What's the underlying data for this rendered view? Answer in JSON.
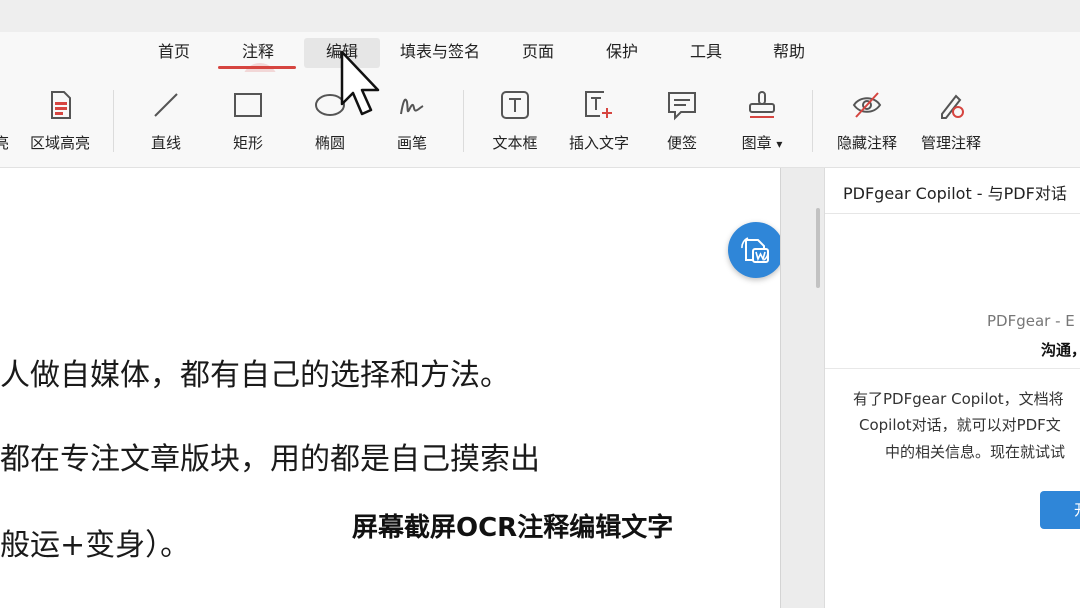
{
  "menu": {
    "tabs": [
      {
        "label": "首页"
      },
      {
        "label": "注释"
      },
      {
        "label": "编辑"
      },
      {
        "label": "填表与签名"
      },
      {
        "label": "页面"
      },
      {
        "label": "保护"
      },
      {
        "label": "工具"
      },
      {
        "label": "帮助"
      }
    ],
    "active_tab": "注释",
    "accent_color": "#d64540"
  },
  "toolbar": {
    "items": [
      {
        "label": "区域高亮",
        "icon": "area-highlight-icon"
      },
      {
        "label": "直线",
        "icon": "line-icon"
      },
      {
        "label": "矩形",
        "icon": "rectangle-icon"
      },
      {
        "label": "椭圆",
        "icon": "ellipse-icon"
      },
      {
        "label": "画笔",
        "icon": "pen-icon"
      },
      {
        "label": "文本框",
        "icon": "textbox-icon"
      },
      {
        "label": "插入文字",
        "icon": "insert-text-icon"
      },
      {
        "label": "便签",
        "icon": "sticky-note-icon"
      },
      {
        "label": "图章",
        "icon": "stamp-icon",
        "dropdown": "▾"
      },
      {
        "label": "隐藏注释",
        "icon": "hide-annotation-icon"
      },
      {
        "label": "管理注释",
        "icon": "manage-annotation-icon"
      }
    ],
    "partial_left_label": "亮"
  },
  "document": {
    "lines": [
      "人做自媒体，都有自己的选择和方法。",
      "都在专注文章版块，用的都是自己摸索出",
      "般运+变身）。"
    ],
    "overlay_caption": "屏幕截屏OCR注释编辑文字"
  },
  "copilot": {
    "title": "PDFgear Copilot - 与PDF对话",
    "brand_line": "PDFgear - E",
    "bold_line": "沟通，",
    "body_lines": [
      "有了PDFgear Copilot，文档将",
      "Copilot对话，就可以对PDF文",
      "中的相关信息。现在就试试"
    ],
    "button_label": "开"
  },
  "colors": {
    "primary_blue": "#2f86d8"
  }
}
